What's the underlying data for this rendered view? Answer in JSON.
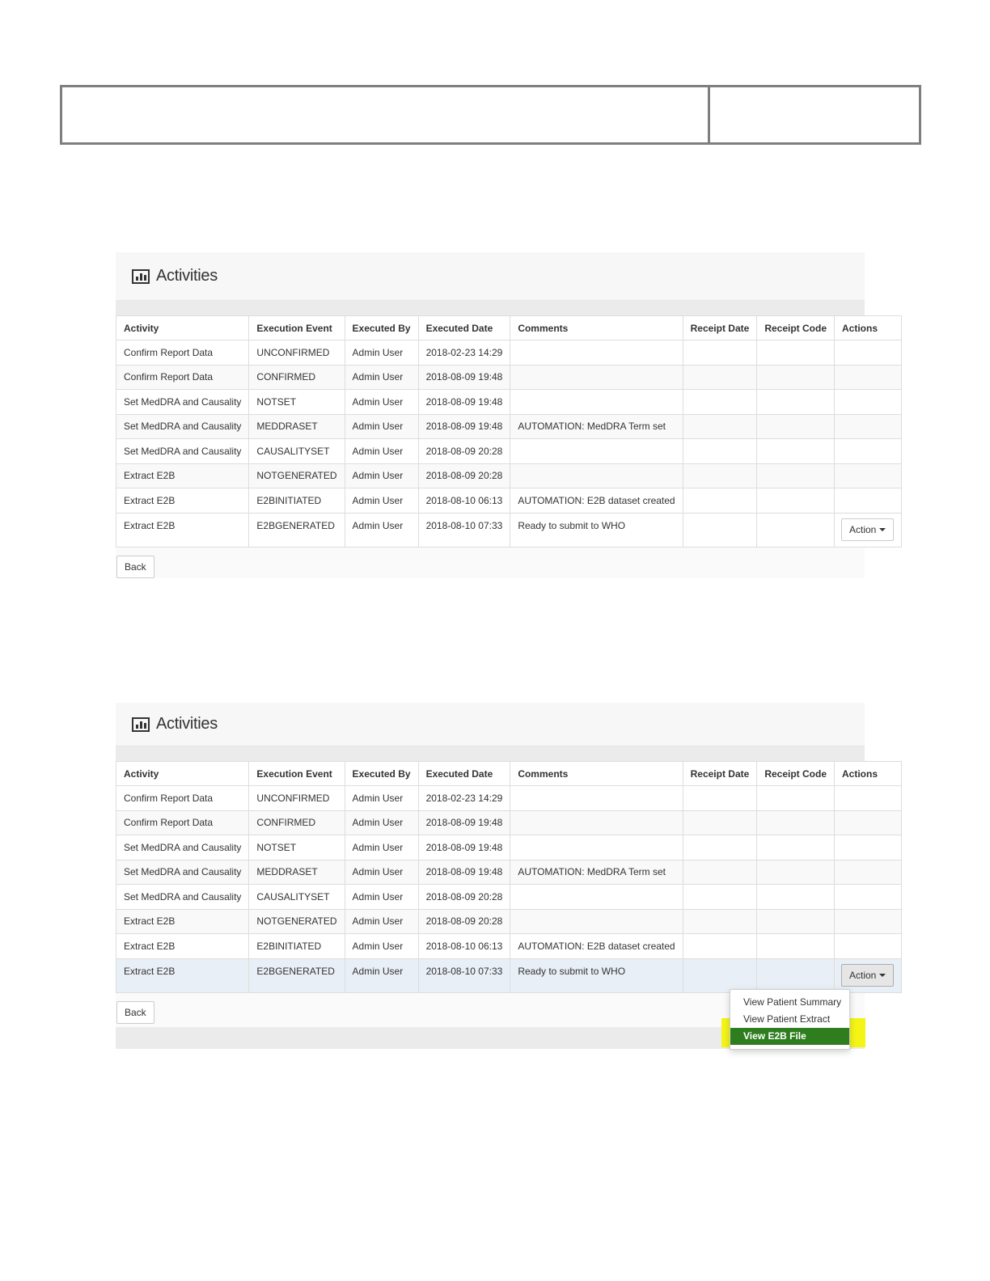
{
  "panels": [
    {
      "title": "Activities",
      "columns": [
        "Activity",
        "Execution Event",
        "Executed By",
        "Executed Date",
        "Comments",
        "Receipt Date",
        "Receipt Code",
        "Actions"
      ],
      "rows": [
        [
          "Confirm Report Data",
          "UNCONFIRMED",
          "Admin User",
          "2018-02-23 14:29",
          "",
          "",
          "",
          ""
        ],
        [
          "Confirm Report Data",
          "CONFIRMED",
          "Admin User",
          "2018-08-09 19:48",
          "",
          "",
          "",
          ""
        ],
        [
          "Set MedDRA and Causality",
          "NOTSET",
          "Admin User",
          "2018-08-09 19:48",
          "",
          "",
          "",
          ""
        ],
        [
          "Set MedDRA and Causality",
          "MEDDRASET",
          "Admin User",
          "2018-08-09 19:48",
          "AUTOMATION: MedDRA Term set",
          "",
          "",
          ""
        ],
        [
          "Set MedDRA and Causality",
          "CAUSALITYSET",
          "Admin User",
          "2018-08-09 20:28",
          "",
          "",
          "",
          ""
        ],
        [
          "Extract E2B",
          "NOTGENERATED",
          "Admin User",
          "2018-08-09 20:28",
          "",
          "",
          "",
          ""
        ],
        [
          "Extract E2B",
          "E2BINITIATED",
          "Admin User",
          "2018-08-10 06:13",
          "AUTOMATION: E2B dataset created",
          "",
          "",
          ""
        ],
        [
          "Extract E2B",
          "E2BGENERATED",
          "Admin User",
          "2018-08-10 07:33",
          "Ready to submit to WHO",
          "",
          "",
          ""
        ]
      ],
      "action_label": "Action",
      "back_label": "Back"
    },
    {
      "title": "Activities",
      "columns": [
        "Activity",
        "Execution Event",
        "Executed By",
        "Executed Date",
        "Comments",
        "Receipt Date",
        "Receipt Code",
        "Actions"
      ],
      "rows": [
        [
          "Confirm Report Data",
          "UNCONFIRMED",
          "Admin User",
          "2018-02-23 14:29",
          "",
          "",
          "",
          ""
        ],
        [
          "Confirm Report Data",
          "CONFIRMED",
          "Admin User",
          "2018-08-09 19:48",
          "",
          "",
          "",
          ""
        ],
        [
          "Set MedDRA and Causality",
          "NOTSET",
          "Admin User",
          "2018-08-09 19:48",
          "",
          "",
          "",
          ""
        ],
        [
          "Set MedDRA and Causality",
          "MEDDRASET",
          "Admin User",
          "2018-08-09 19:48",
          "AUTOMATION: MedDRA Term set",
          "",
          "",
          ""
        ],
        [
          "Set MedDRA and Causality",
          "CAUSALITYSET",
          "Admin User",
          "2018-08-09 20:28",
          "",
          "",
          "",
          ""
        ],
        [
          "Extract E2B",
          "NOTGENERATED",
          "Admin User",
          "2018-08-09 20:28",
          "",
          "",
          "",
          ""
        ],
        [
          "Extract E2B",
          "E2BINITIATED",
          "Admin User",
          "2018-08-10 06:13",
          "AUTOMATION: E2B dataset created",
          "",
          "",
          ""
        ],
        [
          "Extract E2B",
          "E2BGENERATED",
          "Admin User",
          "2018-08-10 07:33",
          "Ready to submit to WHO",
          "",
          "",
          ""
        ]
      ],
      "action_label": "Action",
      "back_label": "Back",
      "dropdown": {
        "items": [
          "View Patient Summary",
          "View Patient Extract",
          "View E2B File"
        ],
        "selected_index": 2
      }
    }
  ],
  "colors": {
    "highlight": "#f4f516",
    "selected_item": "#2e7d1f",
    "hover_row": "#e9eff6"
  },
  "icons": {
    "panel_title": "bar-chart-icon",
    "action_button": "caret-down-icon"
  }
}
